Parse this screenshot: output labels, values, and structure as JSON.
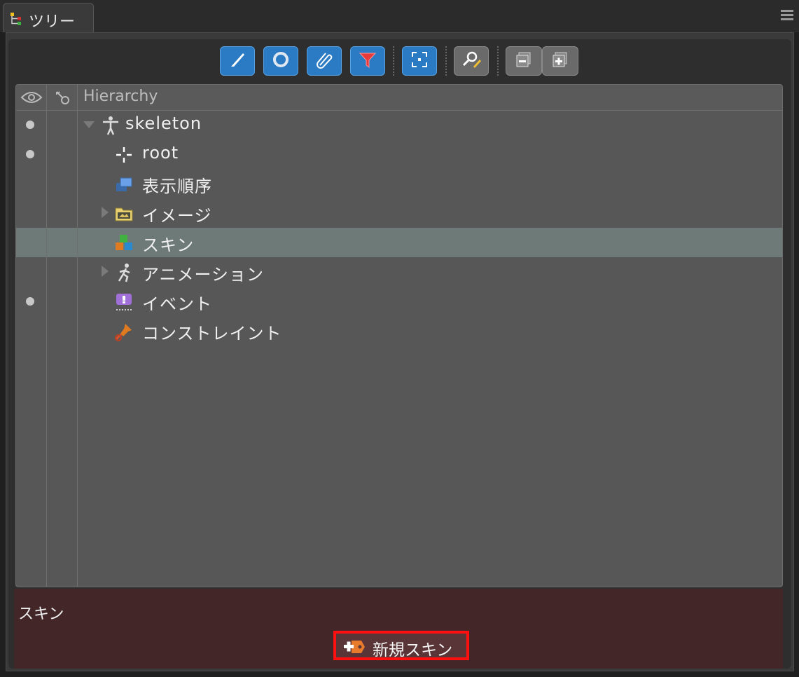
{
  "tab": {
    "label": "ツリー",
    "icon": "tree-icon"
  },
  "toolbar": [
    {
      "name": "bones-filter-button",
      "icon": "bone-icon",
      "style": "blue"
    },
    {
      "name": "slots-filter-button",
      "icon": "ring-icon",
      "style": "blue"
    },
    {
      "name": "attachments-filter-button",
      "icon": "paperclip-icon",
      "style": "blue"
    },
    {
      "name": "filter-button",
      "icon": "funnel-icon",
      "style": "blue"
    },
    {
      "name": "focus-button",
      "icon": "focus-icon",
      "style": "blue"
    },
    {
      "name": "search-button",
      "icon": "search-icon",
      "style": "gray"
    },
    {
      "name": "collapse-all-button",
      "icon": "collapse-icon",
      "style": "gray"
    },
    {
      "name": "expand-all-button",
      "icon": "expand-icon",
      "style": "gray"
    }
  ],
  "tree": {
    "header": "Hierarchy",
    "header_icons": [
      "eye-icon",
      "key-icon"
    ],
    "rows": [
      {
        "label": "skeleton",
        "icon": "skeleton-icon",
        "visible_dot": true,
        "expander": "expanded",
        "selected": false
      },
      {
        "label": "root",
        "icon": "bone-root-icon",
        "visible_dot": true,
        "expander": "none",
        "selected": false
      },
      {
        "label": "表示順序",
        "icon": "draw-order-icon",
        "visible_dot": false,
        "expander": "none",
        "selected": false
      },
      {
        "label": "イメージ",
        "icon": "folder-icon",
        "visible_dot": false,
        "expander": "collapsed",
        "selected": false
      },
      {
        "label": "スキン",
        "icon": "skins-icon",
        "visible_dot": false,
        "expander": "none",
        "selected": true
      },
      {
        "label": "アニメーション",
        "icon": "animation-icon",
        "visible_dot": false,
        "expander": "collapsed",
        "selected": false
      },
      {
        "label": "イベント",
        "icon": "event-icon",
        "visible_dot": true,
        "expander": "none",
        "selected": false
      },
      {
        "label": "コンストレイント",
        "icon": "constraint-icon",
        "visible_dot": false,
        "expander": "none",
        "selected": false
      }
    ]
  },
  "properties": {
    "title": "スキン",
    "new_skin_label": "新規スキン",
    "new_skin_icon": "new-skin-icon"
  },
  "colors": {
    "accent_blue": "#2b7bc4",
    "selection": "#6e7a78",
    "properties_bg": "#432628",
    "highlight": "#ff1010"
  }
}
